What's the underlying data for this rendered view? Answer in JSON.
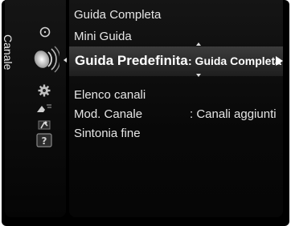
{
  "menu": {
    "category": "Canale",
    "items": [
      {
        "label": "Guida Completa",
        "value": ""
      },
      {
        "label": "Mini Guida",
        "value": ""
      },
      {
        "label": "Guida Predefinita",
        "value": ": Guida Completa"
      },
      {
        "label": "Elenco canali",
        "value": ""
      },
      {
        "label": "Mod. Canale",
        "value": ": Canali aggiunti"
      },
      {
        "label": "Sintonia fine",
        "value": ""
      }
    ],
    "selected_index": 2
  },
  "sidebar_icons": [
    "clock-icon",
    "antenna-icon",
    "gear-icon",
    "input-icon",
    "setup-icon",
    "help-icon"
  ],
  "colors": {
    "background": "#000000",
    "text": "#e6e6e6",
    "highlight": "#2e2e2e"
  }
}
